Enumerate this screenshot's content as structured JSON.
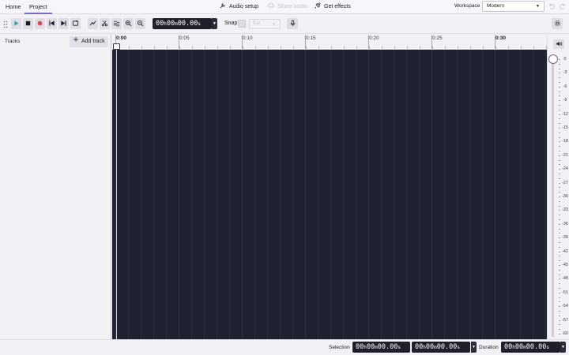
{
  "tabs": [
    {
      "label": "Home"
    },
    {
      "label": "Project"
    }
  ],
  "top_actions": {
    "audio_setup": "Audio setup",
    "share_audio": "Share audio",
    "get_effects": "Get effects"
  },
  "workspace": {
    "label": "Workspace",
    "value": "Modern"
  },
  "transport": {
    "time_main": "00h00m00.00s",
    "time_h": "00",
    "time_m": "00",
    "time_s": "00.00"
  },
  "snap": {
    "label": "Snap",
    "value": "Bar"
  },
  "tracks_panel": {
    "title": "Tracks",
    "add_track": "Add track"
  },
  "ruler": {
    "labels": [
      "0:00",
      "0:05",
      "0:10",
      "0:15",
      "0:20",
      "0:25",
      "0:30"
    ]
  },
  "meter": {
    "labels": [
      "0",
      "-3",
      "-6",
      "-9",
      "-12",
      "-15",
      "-18",
      "-21",
      "-24",
      "-27",
      "-30",
      "-33",
      "-36",
      "-39",
      "-42",
      "-45",
      "-48",
      "-51",
      "-54",
      "-57",
      "-60"
    ]
  },
  "bottom": {
    "selection_label": "Selection",
    "selection_start": {
      "h": "00",
      "m": "00",
      "s": "00.00"
    },
    "selection_end": {
      "h": "00",
      "m": "00",
      "s": "00.00"
    },
    "duration_label": "Duration",
    "duration": {
      "h": "00",
      "m": "00",
      "s": "00.00"
    }
  },
  "colors": {
    "accent": "#7b63d8",
    "track_bg": "#1f2130",
    "record": "#e0445a",
    "play": "#3aa6a0"
  }
}
